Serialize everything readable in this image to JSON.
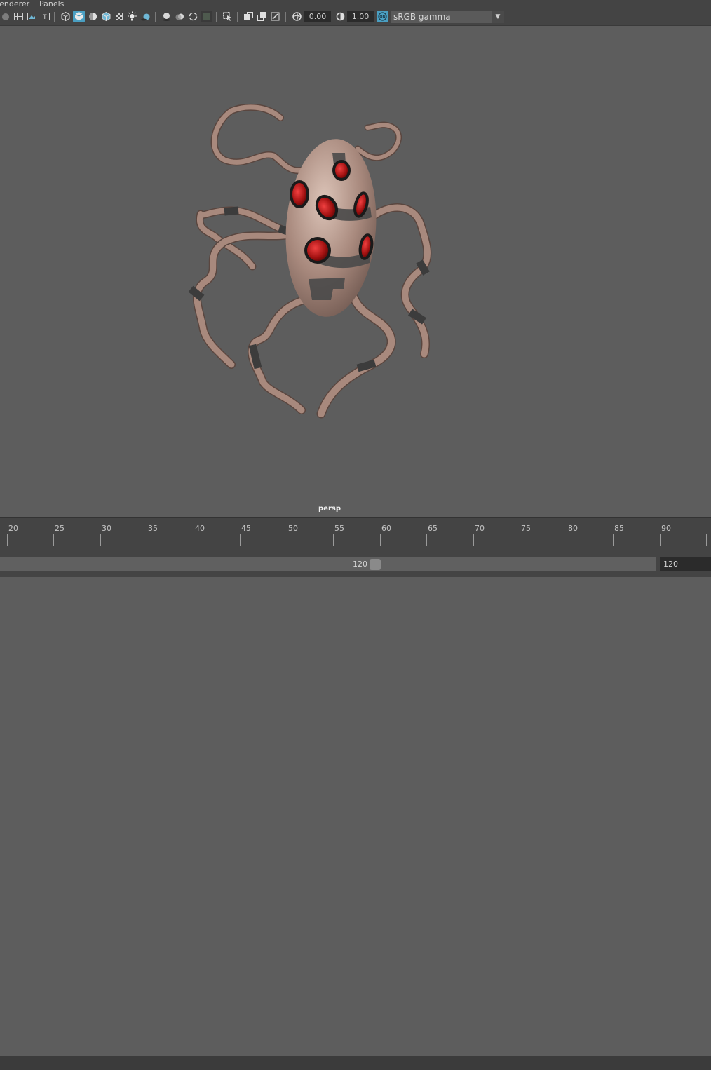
{
  "menus": [
    "Renderer",
    "Panels"
  ],
  "toolbar": {
    "exposure_value": "0.00",
    "gamma_value": "1.00",
    "color_management_badge": "ON",
    "color_space": "sRGB gamma"
  },
  "viewport": {
    "camera_label": "persp"
  },
  "timeline": {
    "ticks": [
      "20",
      "25",
      "30",
      "35",
      "40",
      "45",
      "50",
      "55",
      "60",
      "65",
      "70",
      "75",
      "80",
      "85",
      "90"
    ]
  },
  "range": {
    "end_value": "120",
    "playback_end": "120"
  },
  "colors": {
    "viewport_bg": "#5d5d5d",
    "ui_panel": "#444444",
    "model_skin": "#a8897d",
    "eye_red": "#a01010",
    "accent_active": "#4a9fc2"
  }
}
